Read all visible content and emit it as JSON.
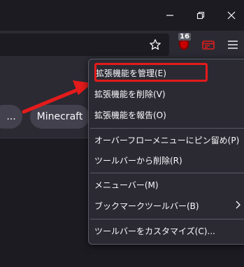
{
  "window": {
    "minimize_icon": "minimize-icon",
    "restore_icon": "restore-icon",
    "close_icon": "close-icon"
  },
  "toolbar": {
    "bookmark_star_icon": "star-icon",
    "extension_badge": "16",
    "extension_icon": "ublock-icon",
    "container_icon": "container-tab-icon",
    "menu_icon": "hamburger-menu-icon"
  },
  "bookmarks": {
    "items": [
      {
        "label": "..."
      },
      {
        "label": "Minecraft"
      }
    ]
  },
  "context_menu": {
    "items": [
      {
        "label": "拡張機能を管理(E)"
      },
      {
        "label": "拡張機能を削除(V)"
      },
      {
        "label": "拡張機能を報告(O)"
      },
      {
        "label": "オーバーフローメニューにピン留め(P)"
      },
      {
        "label": "ツールバーから削除(R)"
      },
      {
        "label": "メニューバー(M)"
      },
      {
        "label": "ブックマークツールバー(B)"
      },
      {
        "label": "ツールバーをカスタマイズ(C)..."
      }
    ]
  },
  "annotation": {
    "highlight_color": "#e31b1b",
    "arrow_color": "#e31b1b"
  }
}
